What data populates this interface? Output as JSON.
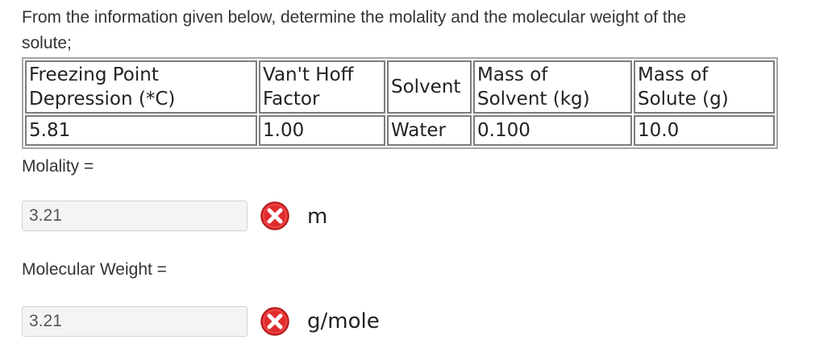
{
  "question": {
    "line1": "From the information given below, determine the molality and the molecular weight of the",
    "line2": "solute;"
  },
  "table": {
    "headers": [
      {
        "line1": "Freezing Point",
        "line2": "Depression (*C)"
      },
      {
        "line1": "Van't Hoff",
        "line2": "Factor"
      },
      {
        "line1": "Solvent",
        "line2": ""
      },
      {
        "line1": "Mass of",
        "line2": "Solvent (kg)"
      },
      {
        "line1": "Mass of",
        "line2": "Solute (g)"
      }
    ],
    "values": [
      "5.81",
      "1.00",
      "Water",
      "0.100",
      "10.0"
    ]
  },
  "molality": {
    "label": "Molality =",
    "value": "3.21",
    "unit": "m",
    "status_icon": "incorrect-x-icon",
    "status_color": "#e02b2b"
  },
  "molecular_weight": {
    "label": "Molecular Weight =",
    "value": "3.21",
    "unit": "g/mole",
    "status_icon": "incorrect-x-icon",
    "status_color": "#e02b2b"
  }
}
